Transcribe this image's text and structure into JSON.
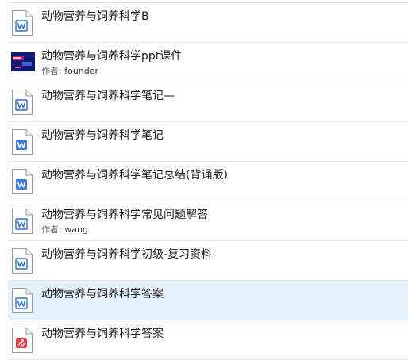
{
  "files": [
    {
      "title": "动物营养与饲养科学B",
      "icon": "word-doc-icon"
    },
    {
      "title": "动物营养与饲养科学ppt课件",
      "icon": "image-thumbnail",
      "author_label": "作者:",
      "author": "founder"
    },
    {
      "title": "动物营养与饲养科学笔记—",
      "icon": "word-doc-icon"
    },
    {
      "title": "动物营养与饲养科学笔记",
      "icon": "word-doc-icon"
    },
    {
      "title": "动物营养与饲养科学笔记总结(背诵版)",
      "icon": "word-doc-icon"
    },
    {
      "title": "动物营养与饲养科学常见问题解答",
      "icon": "word-doc-icon",
      "author_label": "作者:",
      "author": "wang"
    },
    {
      "title": "动物营养与饲养科学初级-复习资料",
      "icon": "word-doc-icon"
    },
    {
      "title": "动物营养与饲养科学答案",
      "icon": "word-doc-icon",
      "selected": true
    },
    {
      "title": "动物营养与饲养科学答案",
      "icon": "pdf-doc-icon"
    }
  ],
  "colors": {
    "word_accent": "#2b6fd6",
    "pdf_accent": "#e0474c",
    "selected_bg": "#e5f1fb"
  }
}
